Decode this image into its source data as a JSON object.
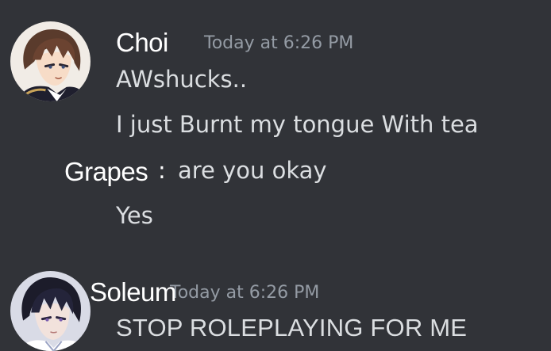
{
  "colors": {
    "background": "#313338",
    "username": "#ffffff",
    "timestamp": "#949ba4",
    "message_text": "#dbdee1"
  },
  "messages": [
    {
      "author": "Choi",
      "timestamp": "Today at 6:26 PM",
      "avatar_icon": "anime-boy-avatar",
      "lines": [
        "AWshucks..",
        "I  just Burnt my tongue   With tea"
      ]
    },
    {
      "inline_author": "Grapes",
      "inline_separator": ":",
      "lines": [
        "are you okay",
        "Yes"
      ]
    },
    {
      "author": "Soleum",
      "timestamp": "Today at 6:26 PM",
      "avatar_icon": "anime-man-avatar",
      "lines": [
        "STOP ROLEPLAYING FOR ME"
      ]
    }
  ]
}
